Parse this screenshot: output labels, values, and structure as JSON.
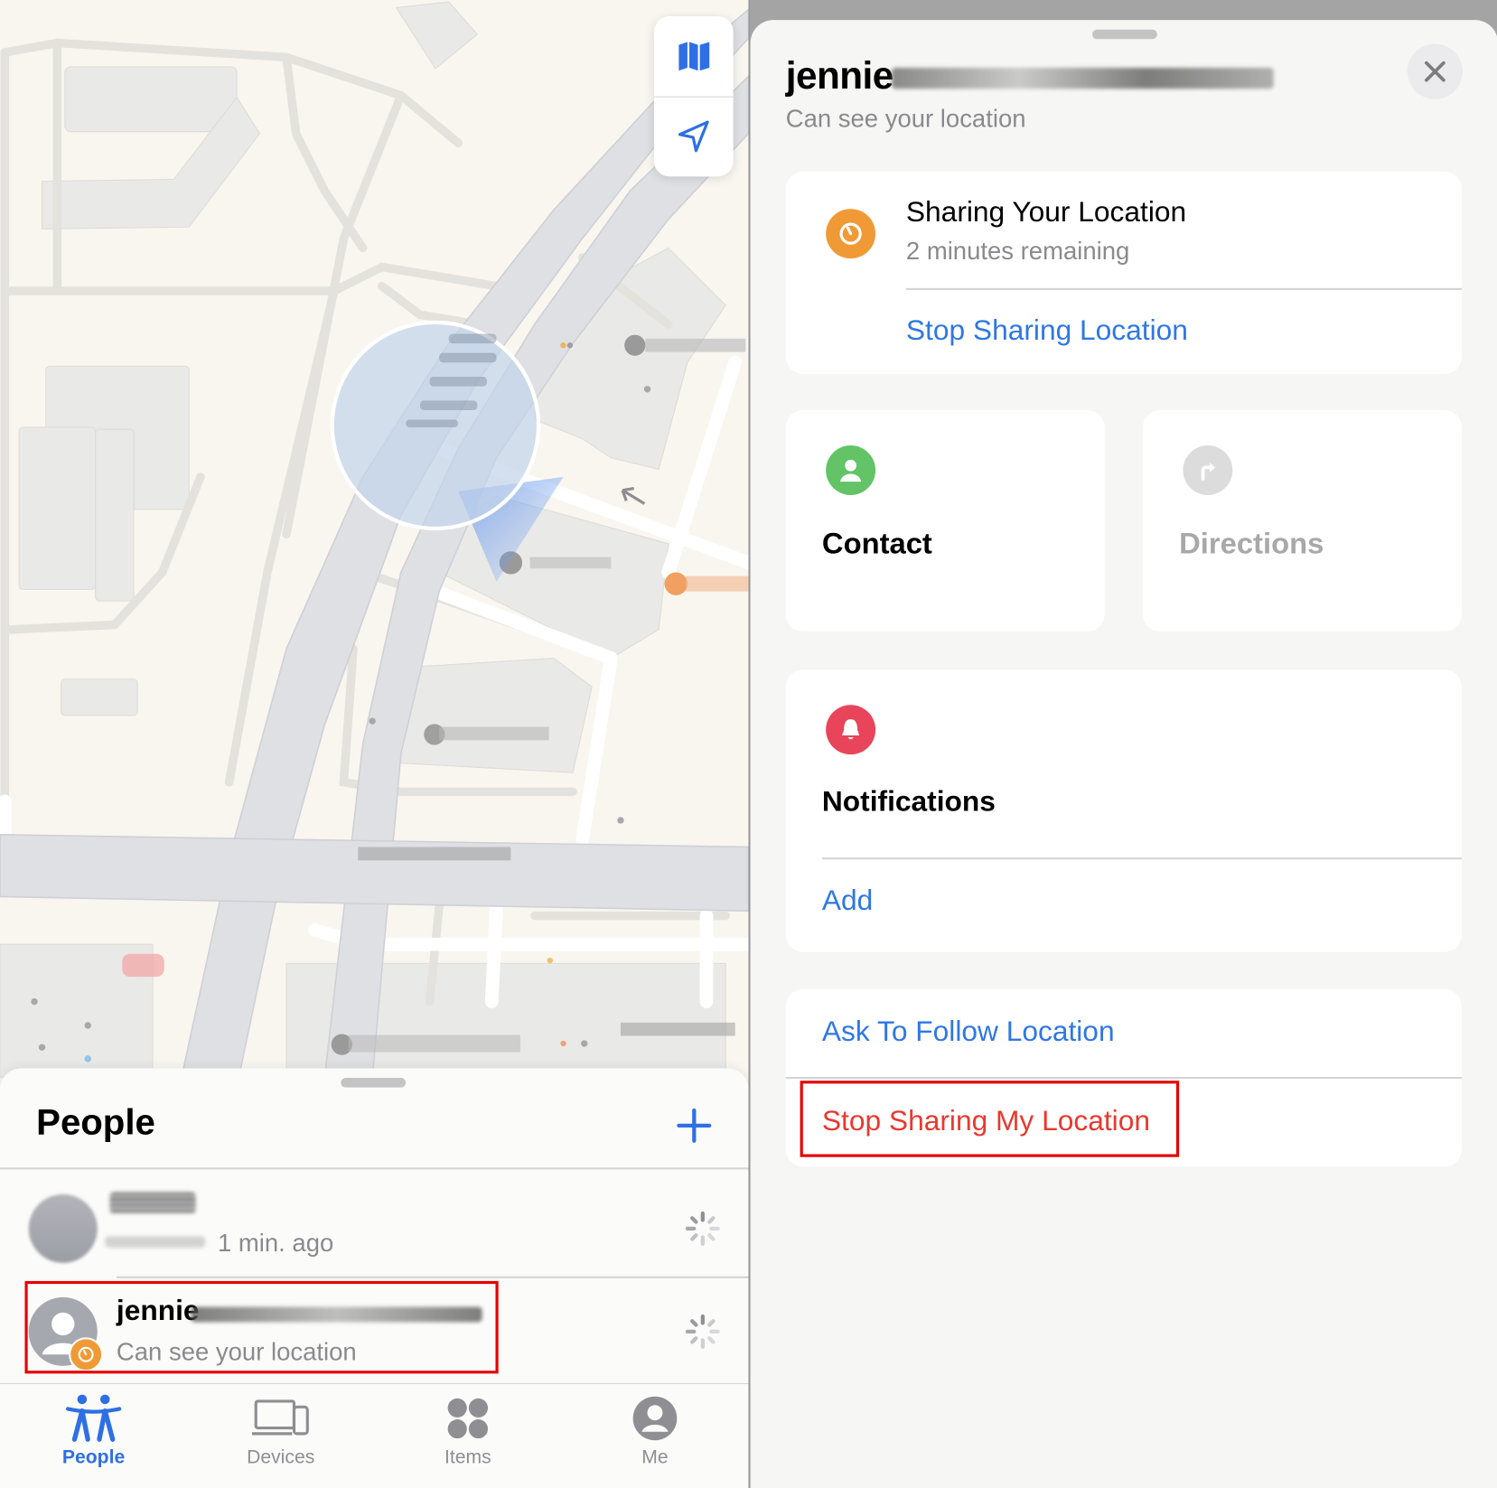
{
  "map": {
    "controls": [
      {
        "icon": "map-icon",
        "label": "Map style"
      },
      {
        "icon": "location-arrow-icon",
        "label": "Current location"
      }
    ]
  },
  "people_sheet": {
    "title": "People",
    "add_icon": "plus-icon",
    "people": [
      {
        "name": "",
        "subtitle": "1 min. ago",
        "name_redacted": true,
        "status_icon": "loading-spinner-icon"
      },
      {
        "name": "jennie",
        "subtitle": "Can see your location",
        "name_redacted": true,
        "badge_icon": "timer-icon",
        "status_icon": "loading-spinner-icon",
        "highlighted": true
      }
    ]
  },
  "tabbar": {
    "tabs": [
      {
        "label": "People",
        "icon": "people-icon",
        "active": true
      },
      {
        "label": "Devices",
        "icon": "devices-icon",
        "active": false
      },
      {
        "label": "Items",
        "icon": "items-icon",
        "active": false
      },
      {
        "label": "Me",
        "icon": "me-icon",
        "active": false
      }
    ]
  },
  "detail": {
    "name": "jennie",
    "subtitle": "Can see your location",
    "close_icon": "close-icon",
    "sharing_card": {
      "title": "Sharing Your Location",
      "subtitle": "2 minutes remaining",
      "action": "Stop Sharing Location"
    },
    "contact_card": {
      "label": "Contact"
    },
    "directions_card": {
      "label": "Directions",
      "disabled": true
    },
    "notifications_card": {
      "title": "Notifications",
      "action": "Add"
    },
    "actions_card": {
      "ask_follow": "Ask To Follow Location",
      "stop_sharing_my": "Stop Sharing My Location"
    }
  },
  "colors": {
    "accent_blue": "#2f77e4",
    "destructive_red": "#e8392f",
    "timer_orange": "#f09a36",
    "contact_green": "#62c466",
    "notification_red": "#e9455a",
    "highlight_box": "#e60000"
  }
}
